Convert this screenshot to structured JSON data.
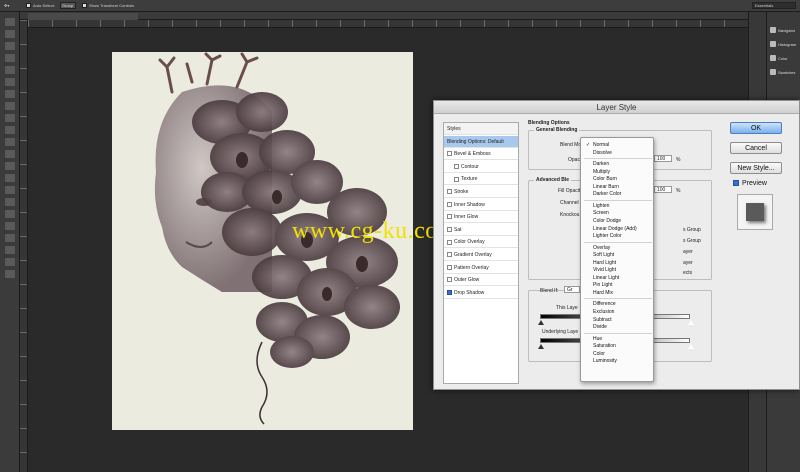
{
  "optionbar": {
    "auto_select_label": "Auto-Select:",
    "auto_select_value": "Group",
    "transform_label": "Show Transform Controls",
    "workspace": "Essentials"
  },
  "panels": {
    "items": [
      {
        "label": "Navigator",
        "icon": "navigator-icon"
      },
      {
        "label": "Histogram",
        "icon": "histogram-icon"
      },
      {
        "label": "Color",
        "icon": "color-icon"
      },
      {
        "label": "Swatches",
        "icon": "swatches-icon"
      }
    ]
  },
  "watermark": "www.cg-ku.com",
  "dialog": {
    "title": "Layer Style",
    "styles_list": [
      {
        "label": "Styles",
        "checkbox": false,
        "checked": false,
        "selected": false,
        "indent": false,
        "header": true
      },
      {
        "label": "Blending Options: Default",
        "checkbox": false,
        "checked": false,
        "selected": true,
        "indent": false,
        "header": false
      },
      {
        "label": "Bevel & Emboss",
        "checkbox": true,
        "checked": false,
        "selected": false,
        "indent": false,
        "header": false
      },
      {
        "label": "Contour",
        "checkbox": true,
        "checked": false,
        "selected": false,
        "indent": true,
        "header": false
      },
      {
        "label": "Texture",
        "checkbox": true,
        "checked": false,
        "selected": false,
        "indent": true,
        "header": false
      },
      {
        "label": "Stroke",
        "checkbox": true,
        "checked": false,
        "selected": false,
        "indent": false,
        "header": false
      },
      {
        "label": "Inner Shadow",
        "checkbox": true,
        "checked": false,
        "selected": false,
        "indent": false,
        "header": false
      },
      {
        "label": "Inner Glow",
        "checkbox": true,
        "checked": false,
        "selected": false,
        "indent": false,
        "header": false
      },
      {
        "label": "Sat",
        "checkbox": true,
        "checked": false,
        "selected": false,
        "indent": false,
        "header": false
      },
      {
        "label": "Color Overlay",
        "checkbox": true,
        "checked": false,
        "selected": false,
        "indent": false,
        "header": false
      },
      {
        "label": "Gradient Overlay",
        "checkbox": true,
        "checked": false,
        "selected": false,
        "indent": false,
        "header": false
      },
      {
        "label": "Pattern Overlay",
        "checkbox": true,
        "checked": false,
        "selected": false,
        "indent": false,
        "header": false
      },
      {
        "label": "Outer Glow",
        "checkbox": true,
        "checked": false,
        "selected": false,
        "indent": false,
        "header": false
      },
      {
        "label": "Drop Shadow",
        "checkbox": true,
        "checked": true,
        "selected": false,
        "indent": false,
        "header": false
      }
    ],
    "blending": {
      "section_title": "Blending Options",
      "general_title": "General Blending",
      "blend_mode_label": "Blend Mode",
      "opacity_label": "Opacity",
      "opacity_value": "100",
      "percent": "%",
      "advanced_title": "Advanced Ble",
      "fill_opacity_label": "Fill Opacity",
      "fill_opacity_value": "100",
      "channels_label": "Channel",
      "knockout_label": "Knockou",
      "opt1": "s Group",
      "opt2": "s Group",
      "opt3": "ayer",
      "opt4": "ayer",
      "opt5": "ects",
      "blend_if_label": "Blend If:",
      "blend_if_value": "Gr",
      "this_layer_label": "This Laye",
      "underlying_label": "Underlying Laye"
    },
    "blend_modes": {
      "selected": "Normal",
      "groups": [
        [
          "Normal",
          "Dissolve"
        ],
        [
          "Darken",
          "Multiply",
          "Color Burn",
          "Linear Burn",
          "Darker Color"
        ],
        [
          "Lighten",
          "Screen",
          "Color Dodge",
          "Linear Dodge (Add)",
          "Lighter Color"
        ],
        [
          "Overlay",
          "Soft Light",
          "Hard Light",
          "Vivid Light",
          "Linear Light",
          "Pin Light",
          "Hard Mix"
        ],
        [
          "Difference",
          "Exclusion",
          "Subtract",
          "Divide"
        ],
        [
          "Hue",
          "Saturation",
          "Color",
          "Luminosity"
        ]
      ]
    },
    "buttons": {
      "ok": "OK",
      "cancel": "Cancel",
      "new_style": "New Style...",
      "preview": "Preview"
    }
  }
}
